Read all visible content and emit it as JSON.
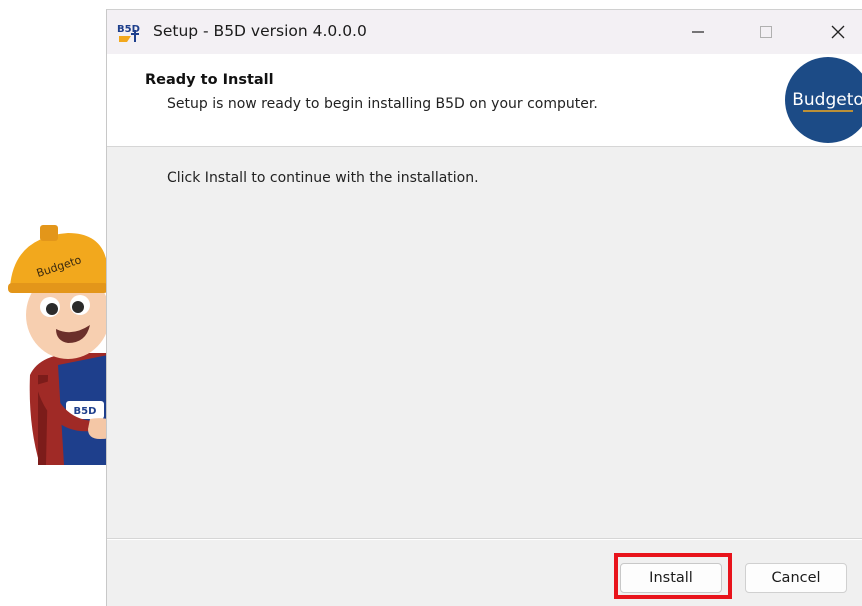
{
  "window": {
    "title": "Setup - B5D version 4.0.0.0",
    "app_icon_text": "B5D",
    "controls": [
      "minimize-icon",
      "maximize-icon",
      "close-icon"
    ]
  },
  "header": {
    "title": "Ready to Install",
    "subtitle": "Setup is now ready to begin installing B5D on your computer.",
    "logo_text": "Budgeto"
  },
  "main": {
    "instruction": "Click Install to continue with the installation."
  },
  "footer": {
    "install_label": "Install",
    "cancel_label": "Cancel"
  },
  "mascot": {
    "helmet_text": "Budgeto",
    "vest_text": "B5D"
  },
  "colors": {
    "highlight": "#e8131b",
    "helmet": "#f2a81d",
    "vest": "#1e3f8c",
    "logo_bg": "#1c4b86"
  }
}
